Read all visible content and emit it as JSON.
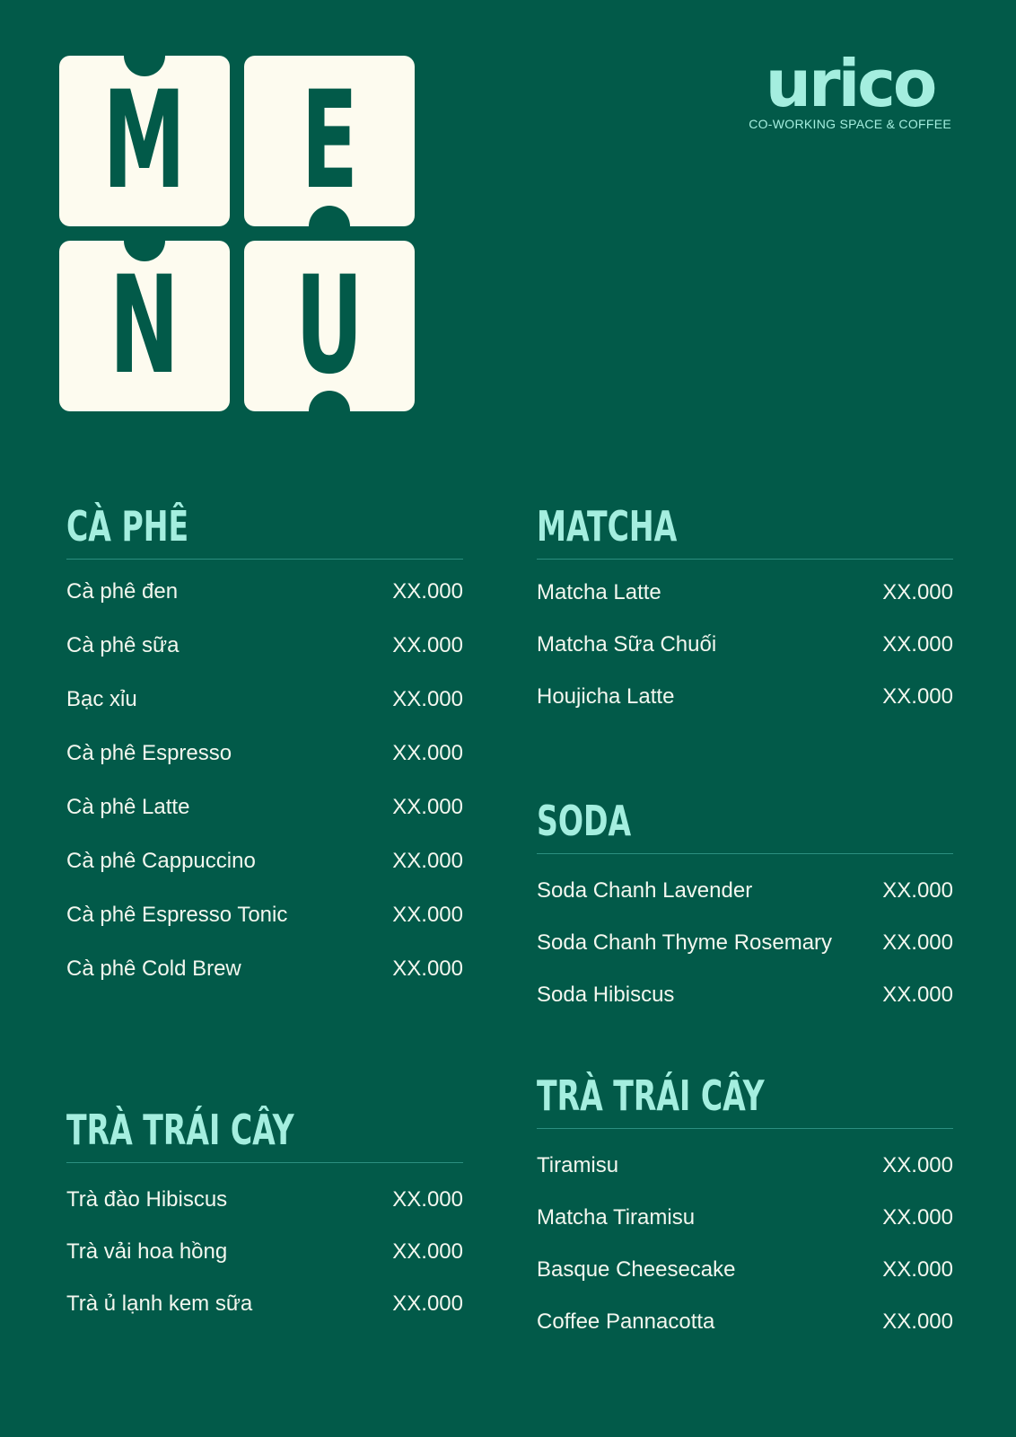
{
  "header": {
    "menu_letters": [
      "M",
      "E",
      "N",
      "U"
    ],
    "logo_word": "urico",
    "logo_tagline": "CO-WORKING SPACE & COFFEE"
  },
  "sections": {
    "caphe": {
      "title": "CÀ PHÊ",
      "items": [
        {
          "name": "Cà phê đen",
          "price": "XX.000"
        },
        {
          "name": "Cà phê sữa",
          "price": "XX.000"
        },
        {
          "name": "Bạc xỉu",
          "price": "XX.000"
        },
        {
          "name": "Cà phê Espresso",
          "price": "XX.000"
        },
        {
          "name": "Cà phê Latte",
          "price": "XX.000"
        },
        {
          "name": "Cà phê Cappuccino",
          "price": "XX.000"
        },
        {
          "name": "Cà phê Espresso Tonic",
          "price": "XX.000"
        },
        {
          "name": "Cà phê Cold Brew",
          "price": "XX.000"
        }
      ]
    },
    "tra": {
      "title": "TRÀ TRÁI CÂY",
      "items": [
        {
          "name": "Trà đào Hibiscus",
          "price": "XX.000"
        },
        {
          "name": "Trà vải hoa hồng",
          "price": "XX.000"
        },
        {
          "name": "Trà ủ lạnh kem sữa",
          "price": "XX.000"
        }
      ]
    },
    "matcha": {
      "title": "MATCHA",
      "items": [
        {
          "name": "Matcha Latte",
          "price": "XX.000"
        },
        {
          "name": "Matcha Sữa Chuối",
          "price": "XX.000"
        },
        {
          "name": "Houjicha Latte",
          "price": "XX.000"
        }
      ]
    },
    "soda": {
      "title": "SODA",
      "items": [
        {
          "name": "Soda Chanh Lavender",
          "price": "XX.000"
        },
        {
          "name": "Soda Chanh Thyme Rosemary",
          "price": "XX.000"
        },
        {
          "name": "Soda Hibiscus",
          "price": "XX.000"
        }
      ]
    },
    "dessert": {
      "title": "TRÀ TRÁI CÂY",
      "items": [
        {
          "name": "Tiramisu",
          "price": "XX.000"
        },
        {
          "name": "Matcha Tiramisu",
          "price": "XX.000"
        },
        {
          "name": "Basque Cheesecake",
          "price": "XX.000"
        },
        {
          "name": "Coffee Pannacotta",
          "price": "XX.000"
        }
      ]
    }
  }
}
